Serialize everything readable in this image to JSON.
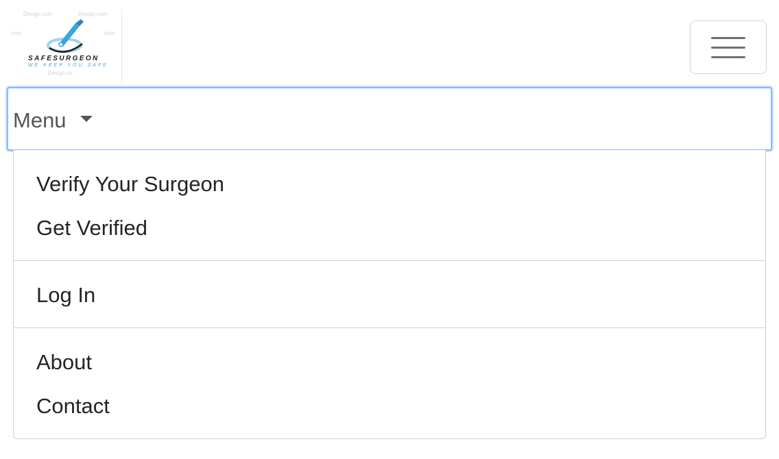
{
  "brand": {
    "name": "SAFESURGEON",
    "tagline": "WE KEEP YOU SAFE"
  },
  "navbar": {
    "toggler_icon": "hamburger-icon"
  },
  "menu": {
    "label": "Menu",
    "caret_icon": "caret-down-icon",
    "groups": [
      {
        "items": [
          "Verify Your Surgeon",
          "Get Verified"
        ]
      },
      {
        "items": [
          "Log In"
        ]
      },
      {
        "items": [
          "About",
          "Contact"
        ]
      }
    ]
  },
  "colors": {
    "focus_ring": "#86b7fe",
    "text": "#212529",
    "muted_text": "#555555",
    "logo_accent": "#3aa5d8"
  }
}
